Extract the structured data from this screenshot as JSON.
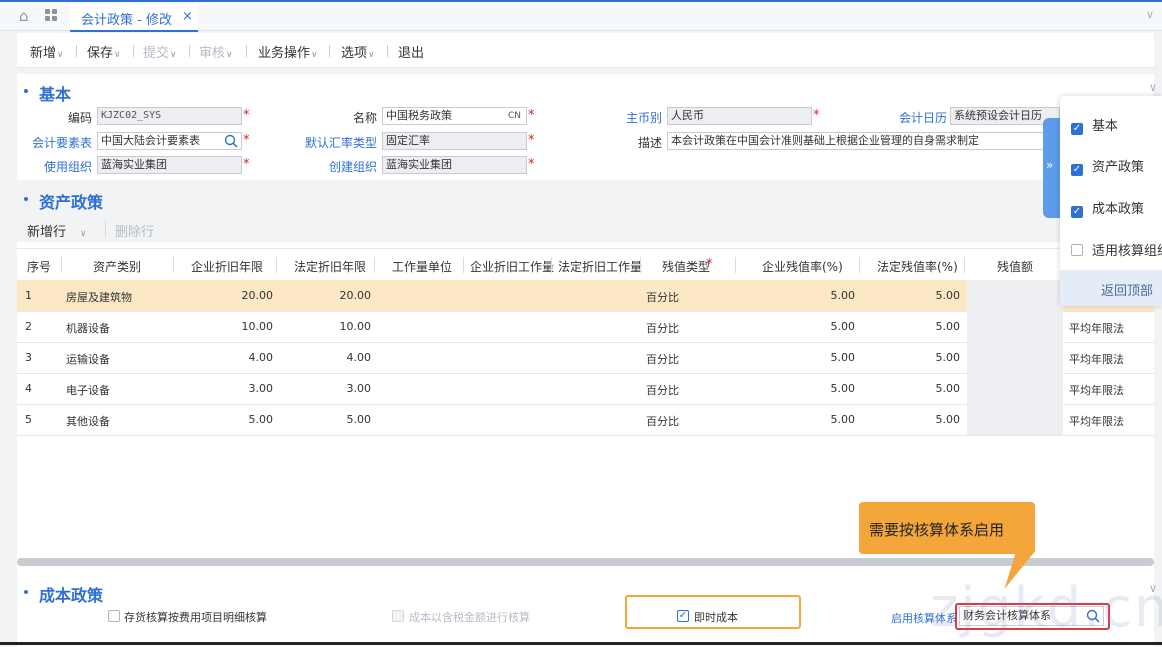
{
  "tab": {
    "title": "会计政策 - 修改",
    "close": "×"
  },
  "toolbar": {
    "new": "新增",
    "save": "保存",
    "submit": "提交",
    "audit": "审核",
    "biz": "业务操作",
    "options": "选项",
    "exit": "退出"
  },
  "basic": {
    "title": "基本",
    "code_label": "编码",
    "code_value": "KJZC02_SYS",
    "name_label": "名称",
    "name_value": "中国税务政策",
    "name_lang": "CN",
    "currency_label": "主币别",
    "currency_value": "人民币",
    "calendar_label": "会计日历",
    "calendar_value": "系统预设会计日历",
    "element_label": "会计要素表",
    "element_value": "中国大陆会计要素表",
    "rate_label": "默认汇率类型",
    "rate_value": "固定汇率",
    "desc_label": "描述",
    "desc_value": "本会计政策在中国会计准则基础上根据企业管理的自身需求制定",
    "useorg_label": "使用组织",
    "useorg_value": "蓝海实业集团",
    "createorg_label": "创建组织",
    "createorg_value": "蓝海实业集团"
  },
  "asset": {
    "title": "资产政策",
    "add_row": "新增行",
    "del_row": "删除行",
    "columns": [
      "序号",
      "资产类别",
      "企业折旧年限",
      "法定折旧年限",
      "工作量单位",
      "企业折旧工作量",
      "法定折旧工作量",
      "残值类型",
      "企业残值率(%)",
      "法定残值率(%)",
      "残值额"
    ],
    "rows": [
      {
        "no": "1",
        "cat": "房屋及建筑物",
        "corp_years": "20.00",
        "legal_years": "20.00",
        "residual_type": "百分比",
        "corp_rate": "5.00",
        "legal_rate": "5.00",
        "method": ""
      },
      {
        "no": "2",
        "cat": "机器设备",
        "corp_years": "10.00",
        "legal_years": "10.00",
        "residual_type": "百分比",
        "corp_rate": "5.00",
        "legal_rate": "5.00",
        "method": "平均年限法"
      },
      {
        "no": "3",
        "cat": "运输设备",
        "corp_years": "4.00",
        "legal_years": "4.00",
        "residual_type": "百分比",
        "corp_rate": "5.00",
        "legal_rate": "5.00",
        "method": "平均年限法"
      },
      {
        "no": "4",
        "cat": "电子设备",
        "corp_years": "3.00",
        "legal_years": "3.00",
        "residual_type": "百分比",
        "corp_rate": "5.00",
        "legal_rate": "5.00",
        "method": "平均年限法"
      },
      {
        "no": "5",
        "cat": "其他设备",
        "corp_years": "5.00",
        "legal_years": "5.00",
        "residual_type": "百分比",
        "corp_rate": "5.00",
        "legal_rate": "5.00",
        "method": "平均年限法"
      }
    ]
  },
  "cost": {
    "title": "成本政策",
    "opt1": "存货核算按费用项目明细核算",
    "opt2": "成本以含税金额进行核算",
    "opt3": "即时成本",
    "system_label": "启用核算体系",
    "system_value": "财务会计核算体系"
  },
  "callout": "需要按核算体系启用",
  "floater": {
    "items": [
      {
        "label": "基本",
        "checked": true
      },
      {
        "label": "资产政策",
        "checked": true
      },
      {
        "label": "成本政策",
        "checked": true
      },
      {
        "label": "适用核算组织",
        "checked": false
      }
    ],
    "back": "返回顶部"
  },
  "watermark": "zjgkd.cn"
}
